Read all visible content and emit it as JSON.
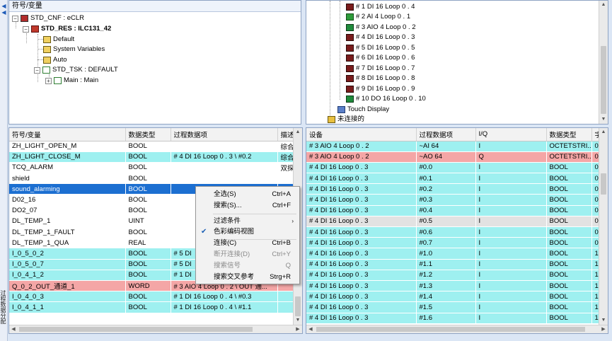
{
  "sidebar": {
    "vertical_label": "过程数据分配"
  },
  "tree_left": {
    "title": "符号/变量",
    "nodes": [
      {
        "label": "STD_CNF : eCLR",
        "icon": "config-icon"
      },
      {
        "label": "STD_RES : ILC131_42",
        "icon": "resource-icon"
      },
      {
        "label": "Default",
        "icon": "variables-icon"
      },
      {
        "label": "System Variables",
        "icon": "variables-icon"
      },
      {
        "label": "Auto",
        "icon": "variables-icon"
      },
      {
        "label": "STD_TSK : DEFAULT",
        "icon": "task-icon"
      },
      {
        "label": "Main : Main",
        "icon": "program-icon"
      }
    ]
  },
  "tree_right": {
    "nodes": [
      {
        "label": "# 1 DI 16 Loop 0 . 4",
        "icon": "di-module-icon"
      },
      {
        "label": "# 2 AI 4 Loop 0 . 1",
        "icon": "ai-module-icon"
      },
      {
        "label": "# 3 AIO 4 Loop 0 . 2",
        "icon": "aio-module-icon"
      },
      {
        "label": "# 4 DI 16 Loop 0 . 3",
        "icon": "di-module-icon"
      },
      {
        "label": "# 5 DI 16 Loop 0 . 5",
        "icon": "di-module-icon"
      },
      {
        "label": "# 6 DI 16 Loop 0 . 6",
        "icon": "di-module-icon"
      },
      {
        "label": "# 7 DI 16 Loop 0 . 7",
        "icon": "di-module-icon"
      },
      {
        "label": "# 8 DI 16 Loop 0 . 8",
        "icon": "di-module-icon"
      },
      {
        "label": "# 9 DI 16 Loop 0 . 9",
        "icon": "di-module-icon"
      },
      {
        "label": "# 10 DO 16 Loop 0 . 10",
        "icon": "do-module-icon"
      },
      {
        "label": "Touch Display",
        "icon": "display-icon"
      },
      {
        "label": "未连接的",
        "icon": "unconnected-icon"
      }
    ]
  },
  "grid_left": {
    "columns": [
      "符号/变量",
      "数据类型",
      "过程数据项",
      "描述"
    ],
    "rows": [
      {
        "cells": [
          "ZH_LIGHT_OPEN_M",
          "BOOL",
          "",
          "综合"
        ],
        "style": "w"
      },
      {
        "cells": [
          "ZH_LIGHT_CLOSE_M",
          "BOOL",
          "# 4 DI 16 Loop 0 . 3 \\ #0.2",
          "综合"
        ],
        "style": "c"
      },
      {
        "cells": [
          "TCQ_ALARM",
          "BOOL",
          "",
          "双探"
        ],
        "style": "w"
      },
      {
        "cells": [
          "shield",
          "BOOL",
          "",
          ""
        ],
        "style": "w"
      },
      {
        "cells": [
          "sound_alarming",
          "BOOL",
          "",
          ""
        ],
        "style": "s"
      },
      {
        "cells": [
          "D02_16",
          "BOOL",
          "",
          ""
        ],
        "style": "w"
      },
      {
        "cells": [
          "DO2_07",
          "BOOL",
          "",
          ""
        ],
        "style": "w"
      },
      {
        "cells": [
          "DL_TEMP_1",
          "UINT",
          "",
          ""
        ],
        "style": "w"
      },
      {
        "cells": [
          "DL_TEMP_1_FAULT",
          "BOOL",
          "",
          ""
        ],
        "style": "w"
      },
      {
        "cells": [
          "DL_TEMP_1_QUA",
          "REAL",
          "",
          ""
        ],
        "style": "w"
      },
      {
        "cells": [
          "I_0_5_0_2",
          "BOOL",
          "# 5 DI",
          ""
        ],
        "style": "c"
      },
      {
        "cells": [
          "I_0_5_0_7",
          "BOOL",
          "# 5 DI",
          ""
        ],
        "style": "c"
      },
      {
        "cells": [
          "I_0_4_1_2",
          "BOOL",
          "# 1 DI",
          ""
        ],
        "style": "c"
      },
      {
        "cells": [
          "Q_0_2_OUT_通道_1",
          "WORD",
          "# 3 AIO 4 Loop 0 . 2 \\ OUT 通...",
          ""
        ],
        "style": "p"
      },
      {
        "cells": [
          "I_0_4_0_3",
          "BOOL",
          "# 1 DI 16 Loop 0 . 4 \\ #0.3",
          ""
        ],
        "style": "c"
      },
      {
        "cells": [
          "I_0_4_1_1",
          "BOOL",
          "# 1 DI 16 Loop 0 . 4 \\ #1.1",
          ""
        ],
        "style": "c"
      }
    ]
  },
  "grid_right": {
    "columns": [
      "设备",
      "过程数据项",
      "I/Q",
      "数据类型",
      "字"
    ],
    "rows": [
      {
        "cells": [
          "# 3 AIO 4 Loop 0 . 2",
          "~AI 64",
          "I",
          "OCTETSTRI...",
          "0."
        ],
        "style": "c"
      },
      {
        "cells": [
          "# 3 AIO 4 Loop 0 . 2",
          "~AO 64",
          "Q",
          "OCTETSTRI...",
          "0."
        ],
        "style": "p"
      },
      {
        "cells": [
          "# 4 DI 16 Loop 0 . 3",
          "#0.0",
          "I",
          "BOOL",
          "0."
        ],
        "style": "c"
      },
      {
        "cells": [
          "# 4 DI 16 Loop 0 . 3",
          "#0.1",
          "I",
          "BOOL",
          "0."
        ],
        "style": "c"
      },
      {
        "cells": [
          "# 4 DI 16 Loop 0 . 3",
          "#0.2",
          "I",
          "BOOL",
          "0."
        ],
        "style": "c"
      },
      {
        "cells": [
          "# 4 DI 16 Loop 0 . 3",
          "#0.3",
          "I",
          "BOOL",
          "0."
        ],
        "style": "c"
      },
      {
        "cells": [
          "# 4 DI 16 Loop 0 . 3",
          "#0.4",
          "I",
          "BOOL",
          "0."
        ],
        "style": "c"
      },
      {
        "cells": [
          "# 4 DI 16 Loop 0 . 3",
          "#0.5",
          "I",
          "BOOL",
          "0."
        ],
        "style": "g"
      },
      {
        "cells": [
          "# 4 DI 16 Loop 0 . 3",
          "#0.6",
          "I",
          "BOOL",
          "0."
        ],
        "style": "c"
      },
      {
        "cells": [
          "# 4 DI 16 Loop 0 . 3",
          "#0.7",
          "I",
          "BOOL",
          "0."
        ],
        "style": "c"
      },
      {
        "cells": [
          "# 4 DI 16 Loop 0 . 3",
          "#1.0",
          "I",
          "BOOL",
          "1."
        ],
        "style": "c"
      },
      {
        "cells": [
          "# 4 DI 16 Loop 0 . 3",
          "#1.1",
          "I",
          "BOOL",
          "1."
        ],
        "style": "c"
      },
      {
        "cells": [
          "# 4 DI 16 Loop 0 . 3",
          "#1.2",
          "I",
          "BOOL",
          "1."
        ],
        "style": "c"
      },
      {
        "cells": [
          "# 4 DI 16 Loop 0 . 3",
          "#1.3",
          "I",
          "BOOL",
          "1."
        ],
        "style": "c"
      },
      {
        "cells": [
          "# 4 DI 16 Loop 0 . 3",
          "#1.4",
          "I",
          "BOOL",
          "1."
        ],
        "style": "c"
      },
      {
        "cells": [
          "# 4 DI 16 Loop 0 . 3",
          "#1.5",
          "I",
          "BOOL",
          "1."
        ],
        "style": "c"
      },
      {
        "cells": [
          "# 4 DI 16 Loop 0 . 3",
          "#1.6",
          "I",
          "BOOL",
          "1."
        ],
        "style": "c"
      }
    ]
  },
  "context_menu": {
    "items": [
      {
        "label": "全选(S)",
        "shortcut": "Ctrl+A",
        "enabled": true
      },
      {
        "label": "搜索(S)...",
        "shortcut": "Ctrl+F",
        "enabled": true
      },
      {
        "label": "过滤条件",
        "shortcut": "",
        "enabled": true,
        "submenu": true
      },
      {
        "label": "色彩编码视图",
        "shortcut": "",
        "enabled": true,
        "checked": true
      },
      {
        "label": "连接(C)",
        "shortcut": "Ctrl+B",
        "enabled": true
      },
      {
        "label": "断开连接(D)",
        "shortcut": "Ctrl+Y",
        "enabled": false
      },
      {
        "label": "搜索信号",
        "shortcut": "Q",
        "enabled": false
      },
      {
        "label": "搜索交叉参考",
        "shortcut": "Strg+R",
        "enabled": true
      }
    ]
  },
  "colors": {
    "cyan_row": "#9ef0f0",
    "pink_row": "#f4a6a6",
    "selected_row": "#1c6fd1"
  }
}
